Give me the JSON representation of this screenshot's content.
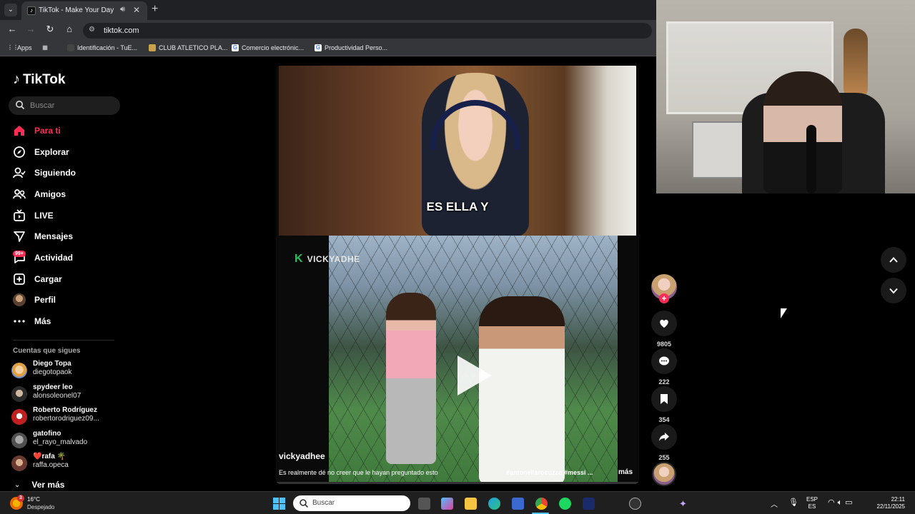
{
  "browser": {
    "tab_title": "TikTok - Make Your Day",
    "url": "tiktok.com",
    "bookmarks": [
      {
        "label": "Apps"
      },
      {
        "label": "Identificación - TuE..."
      },
      {
        "label": "CLUB ATLETICO PLA..."
      },
      {
        "label": "Comercio electrónic..."
      },
      {
        "label": "Productividad Perso..."
      }
    ]
  },
  "tiktok": {
    "logo": "TikTok",
    "search_placeholder": "Buscar",
    "nav": [
      {
        "label": "Para ti",
        "icon": "home-icon",
        "active": true
      },
      {
        "label": "Explorar",
        "icon": "compass-icon"
      },
      {
        "label": "Siguiendo",
        "icon": "following-icon"
      },
      {
        "label": "Amigos",
        "icon": "friends-icon"
      },
      {
        "label": "LIVE",
        "icon": "live-icon"
      },
      {
        "label": "Mensajes",
        "icon": "messages-icon"
      },
      {
        "label": "Actividad",
        "icon": "activity-icon",
        "badge": "99+"
      },
      {
        "label": "Cargar",
        "icon": "upload-icon"
      },
      {
        "label": "Perfil",
        "icon": "profile-avatar"
      },
      {
        "label": "Más",
        "icon": "more-icon"
      }
    ],
    "following_header": "Cuentas que sigues",
    "following": [
      {
        "name": "Diego Topa",
        "handle": "diegotopaok"
      },
      {
        "name": "spydeer leo",
        "handle": "alonsoleonel07"
      },
      {
        "name": "Roberto Rodríguez",
        "handle": "robertorodriguez09..."
      },
      {
        "name": "gatofino",
        "handle": "el_rayo_malvado"
      },
      {
        "name": "❤️rafa 🌴",
        "handle": "raffa.opeca"
      }
    ],
    "see_more": "Ver más",
    "video": {
      "caption_overlay": "ES ELLA Y",
      "watermark_k": "K",
      "watermark_text": "VICKYADHE",
      "author": "vickyadhee",
      "description": "Es realmente dé no creer que le hayan preguntado esto",
      "hashtags": "#antonellarocuzzo #messi ...",
      "more": "más",
      "likes": "9805",
      "comments": "222",
      "saves": "354",
      "shares": "255"
    }
  },
  "taskbar": {
    "weather_alert": "3",
    "temperature": "16°C",
    "condition": "Despejado",
    "search_placeholder": "Buscar",
    "lang_top": "ESP",
    "lang_bottom": "ES",
    "time": "22:11",
    "date": "22/11/2025"
  },
  "colors": {
    "accent": "#fe2c55",
    "background": "#000000"
  }
}
